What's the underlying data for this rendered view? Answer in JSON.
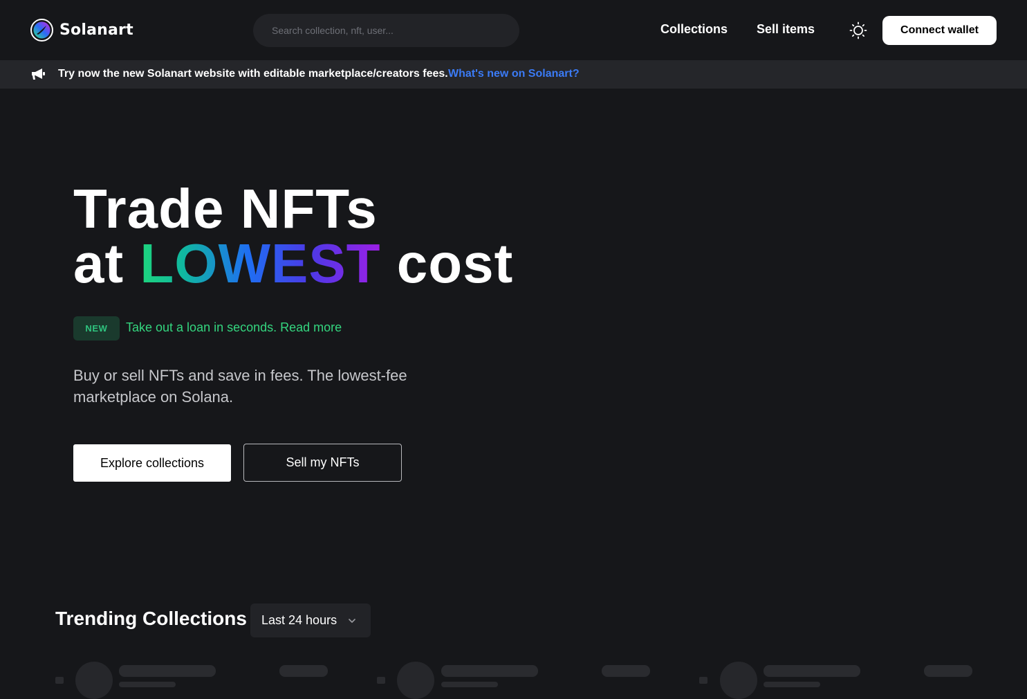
{
  "brand": {
    "name": "Solanart"
  },
  "search": {
    "placeholder": "Search collection, nft, user..."
  },
  "nav": {
    "collections": "Collections",
    "sell_items": "Sell items",
    "connect_wallet": "Connect wallet"
  },
  "banner": {
    "text": "Try now the new Solanart website with editable marketplace/creators fees.",
    "link": "What's new on Solanart?"
  },
  "hero": {
    "line1": "Trade NFTs",
    "line2_prefix": "at ",
    "line2_highlight": "LOWEST",
    "line2_suffix": " cost",
    "badge": "NEW",
    "loan_link": "Take out a loan in seconds. Read more",
    "subtitle": "Buy or sell NFTs and save in fees. The lowest-fee marketplace on Solana.",
    "explore_button": "Explore collections",
    "sell_button": "Sell my NFTs"
  },
  "trending": {
    "title": "Trending Collections",
    "period": "Last 24 hours"
  },
  "icons": {
    "brand_logo": "solanart-logo-icon",
    "theme": "sun-icon",
    "announce": "megaphone-icon",
    "dropdown": "chevron-down-icon"
  },
  "colors": {
    "background": "#16171a",
    "banner_bg": "#25262a",
    "link_blue": "#3b7bf6",
    "accent_green": "#34d67f"
  }
}
